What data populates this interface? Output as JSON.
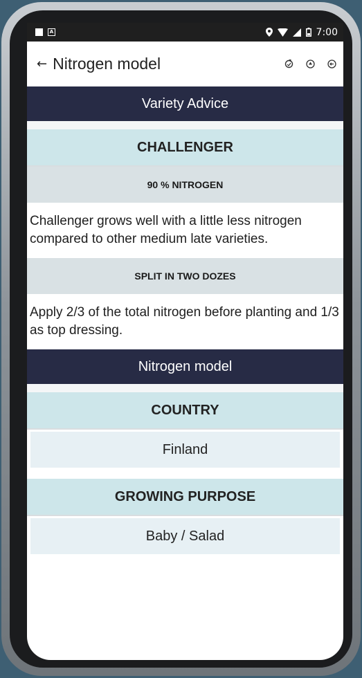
{
  "status_bar": {
    "time": "7:00",
    "left_icons": [
      "image-notification-icon",
      "a-notification-icon"
    ],
    "right_icons": [
      "location-icon",
      "wifi-icon",
      "signal-icon",
      "battery-icon"
    ]
  },
  "app_bar": {
    "back_glyph": "←",
    "title": "Nitrogen model",
    "actions": [
      "refresh-icon",
      "compass-icon",
      "exit-icon"
    ]
  },
  "variety_section": {
    "header": "Variety Advice",
    "variety_name": "CHALLENGER",
    "nitrogen_label": "90 % NITROGEN",
    "nitrogen_text": "Challenger grows well with a little less nitrogen compared to other medium late varieties.",
    "split_label": "SPLIT IN TWO DOZES",
    "split_text": "Apply 2/3 of the total nitrogen before planting and 1/3 as top dressing."
  },
  "model_section": {
    "header": "Nitrogen model",
    "country_label": "COUNTRY",
    "country_value": "Finland",
    "purpose_label": "GROWING PURPOSE",
    "purpose_value": "Baby / Salad"
  },
  "colors": {
    "section_header_bg": "#272b45",
    "title_band_bg": "#cde6ea",
    "sub_band_bg": "#d9e1e4",
    "value_band_bg": "#e7f0f4"
  }
}
